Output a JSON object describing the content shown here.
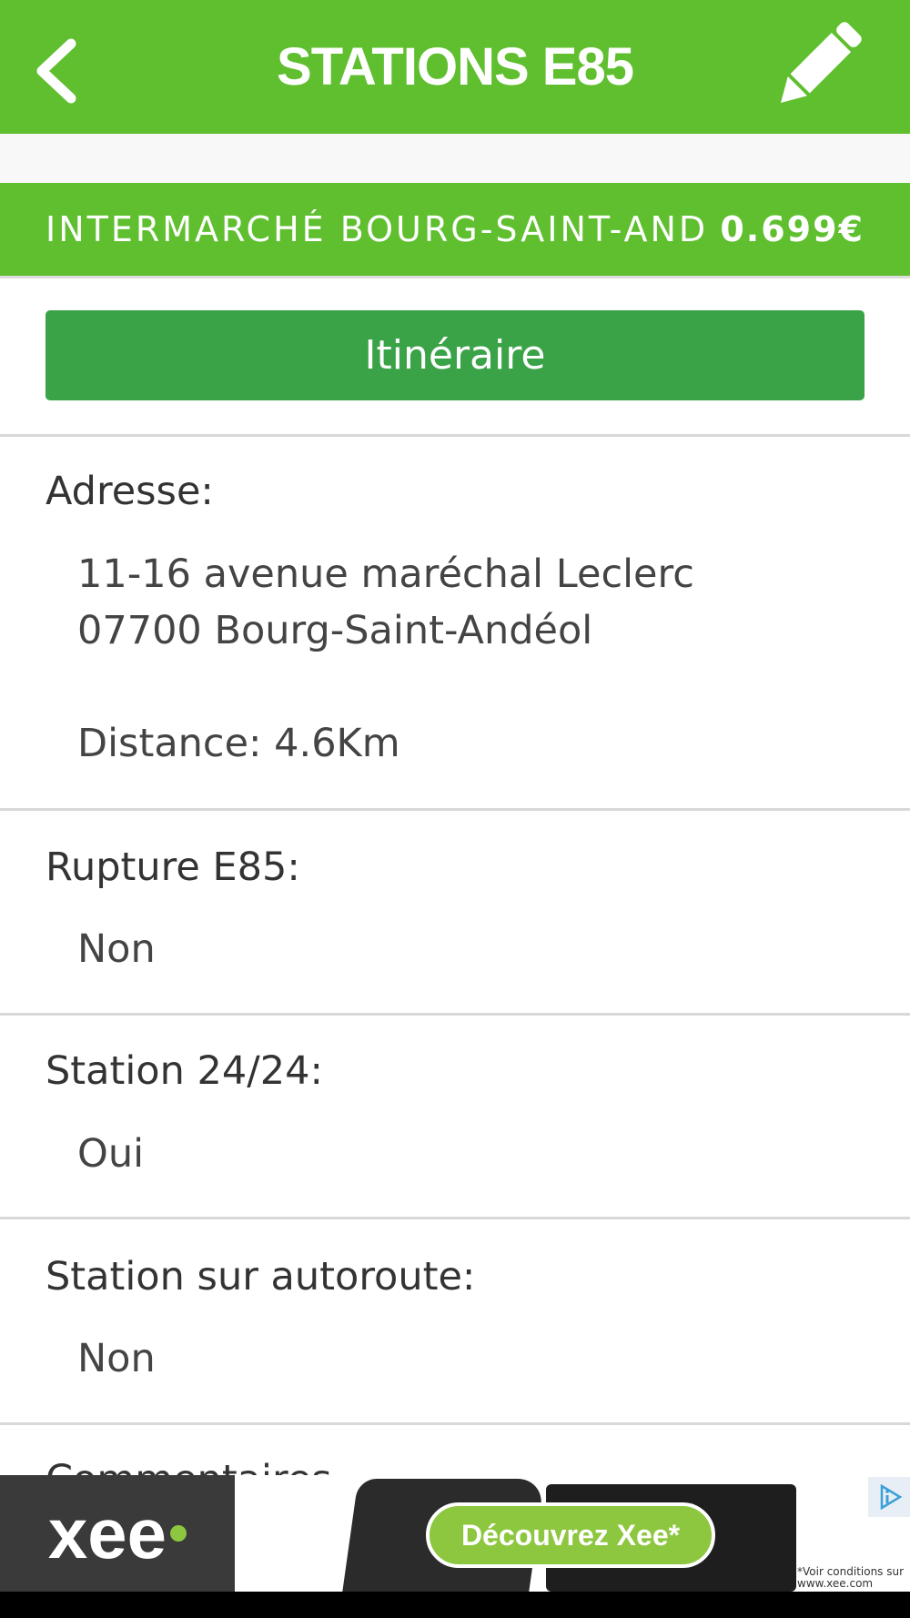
{
  "header": {
    "title": "STATIONS E85",
    "back_icon": "chevron-left-icon",
    "edit_icon": "pencil-icon",
    "color": "#5fbf2f"
  },
  "station": {
    "name": "INTERMARCHÉ BOURG-SAINT-ANDÉOL",
    "price": "0.699€"
  },
  "route_button": {
    "label": "Itinéraire",
    "color": "#3aa347"
  },
  "address": {
    "label": "Adresse:",
    "line1": "11-16 avenue maréchal Leclerc",
    "line2": "07700 Bourg-Saint-Andéol",
    "distance": "Distance: 4.6Km"
  },
  "rupture": {
    "label": "Rupture E85:",
    "value": "Non"
  },
  "open247": {
    "label": "Station 24/24:",
    "value": "Oui"
  },
  "highway": {
    "label": "Station sur autoroute:",
    "value": "Non"
  },
  "comments": {
    "label": "Commentaires"
  },
  "ad": {
    "logo": "xee",
    "cta": "Découvrez Xee*",
    "fine_print": "*Voir conditions sur www.xee.com",
    "info_icon": "ad-info-icon"
  }
}
